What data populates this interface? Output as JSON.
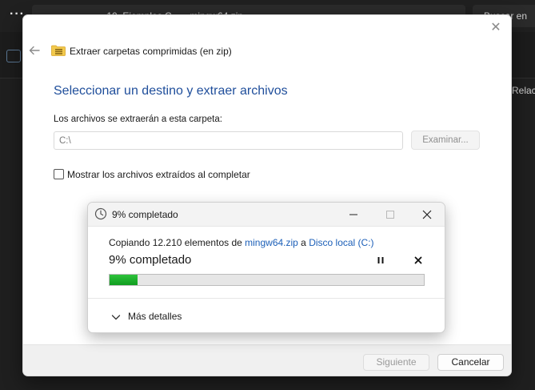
{
  "background": {
    "more_label": "···",
    "address_text": "›   10_Ejemplos C… ›   mingw64.zip   ›",
    "search_text": "Buscar en",
    "right_label": "Relac"
  },
  "extract_dialog": {
    "title": "Extraer carpetas comprimidas (en zip)",
    "heading": "Seleccionar un destino y extraer archivos",
    "destination_label": "Los archivos se extraerán a esta carpeta:",
    "destination_value": "C:\\",
    "browse_label": "Examinar...",
    "show_files_label": "Mostrar los archivos extraídos al completar",
    "show_files_checked": false,
    "next_label": "Siguiente",
    "cancel_label": "Cancelar",
    "heading_color": "#1f4e9b"
  },
  "progress_dialog": {
    "title": "9% completado",
    "copy_prefix": "Copiando 12.210 elementos de ",
    "source_link": "mingw64.zip",
    "copy_middle": " a ",
    "dest_link": "Disco local (C:)",
    "percent_text": "9% completado",
    "progress_fraction": 0.09,
    "more_details_label": "Más detalles",
    "link_color": "#1c5fb8",
    "bar_color": "#14a524"
  },
  "icons": {
    "back": "arrow-left-icon",
    "folder": "zip-folder-icon",
    "close": "close-icon",
    "clock": "clock-icon",
    "minimize": "minimize-icon",
    "maximize": "maximize-icon",
    "pause": "pause-icon",
    "cancel": "cancel-x-icon",
    "chevron": "chevron-down-icon"
  }
}
